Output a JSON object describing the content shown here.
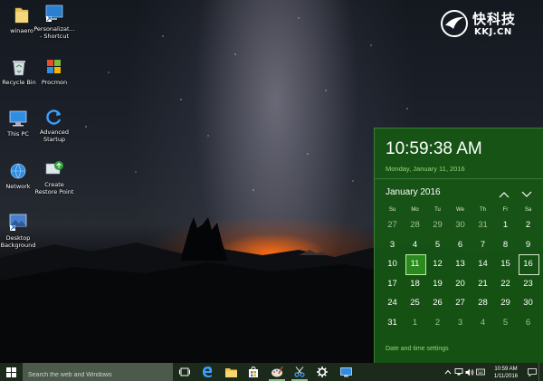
{
  "desktop": {
    "icons": [
      {
        "label": "winaero",
        "icon": "folder-icon"
      },
      {
        "label": "Personalizat... - Shortcut",
        "icon": "monitor-shortcut-icon"
      },
      {
        "label": "Recycle Bin",
        "icon": "recycle-bin-icon"
      },
      {
        "label": "Procmon",
        "icon": "procmon-icon"
      },
      {
        "label": "This PC",
        "icon": "computer-icon"
      },
      {
        "label": "Advanced Startup",
        "icon": "refresh-icon"
      },
      {
        "label": "Network",
        "icon": "network-icon"
      },
      {
        "label": "Create Restore Point",
        "icon": "restore-point-icon"
      },
      {
        "label": "Desktop Background",
        "icon": "desktop-background-icon"
      }
    ]
  },
  "watermark": {
    "text": "快科技",
    "sub": "KKJ.CN"
  },
  "flyout": {
    "time": "10:59:38 AM",
    "date": "Monday, January 11, 2016",
    "month": "January 2016",
    "weekdays": [
      "Su",
      "Mo",
      "Tu",
      "We",
      "Th",
      "Fr",
      "Sa"
    ],
    "days": [
      {
        "d": "27",
        "other": true
      },
      {
        "d": "28",
        "other": true
      },
      {
        "d": "29",
        "other": true
      },
      {
        "d": "30",
        "other": true
      },
      {
        "d": "31",
        "other": true
      },
      {
        "d": "1"
      },
      {
        "d": "2"
      },
      {
        "d": "3"
      },
      {
        "d": "4"
      },
      {
        "d": "5"
      },
      {
        "d": "6"
      },
      {
        "d": "7"
      },
      {
        "d": "8"
      },
      {
        "d": "9"
      },
      {
        "d": "10"
      },
      {
        "d": "11",
        "today": true
      },
      {
        "d": "12"
      },
      {
        "d": "13"
      },
      {
        "d": "14"
      },
      {
        "d": "15"
      },
      {
        "d": "16",
        "selected": true
      },
      {
        "d": "17"
      },
      {
        "d": "18"
      },
      {
        "d": "19"
      },
      {
        "d": "20"
      },
      {
        "d": "21"
      },
      {
        "d": "22"
      },
      {
        "d": "23"
      },
      {
        "d": "24"
      },
      {
        "d": "25"
      },
      {
        "d": "26"
      },
      {
        "d": "27"
      },
      {
        "d": "28"
      },
      {
        "d": "29"
      },
      {
        "d": "30"
      },
      {
        "d": "31"
      },
      {
        "d": "1",
        "other": true
      },
      {
        "d": "2",
        "other": true
      },
      {
        "d": "3",
        "other": true
      },
      {
        "d": "4",
        "other": true
      },
      {
        "d": "5",
        "other": true
      },
      {
        "d": "6",
        "other": true
      }
    ],
    "settings_link": "Date and time settings"
  },
  "taskbar": {
    "search_placeholder": "Search the web and Windows",
    "clock_time": "10:59 AM",
    "clock_date": "1/11/2016"
  },
  "colors": {
    "accent": "#165614",
    "accent_light": "#8fd67c",
    "taskbar": "#1b2a1b"
  }
}
